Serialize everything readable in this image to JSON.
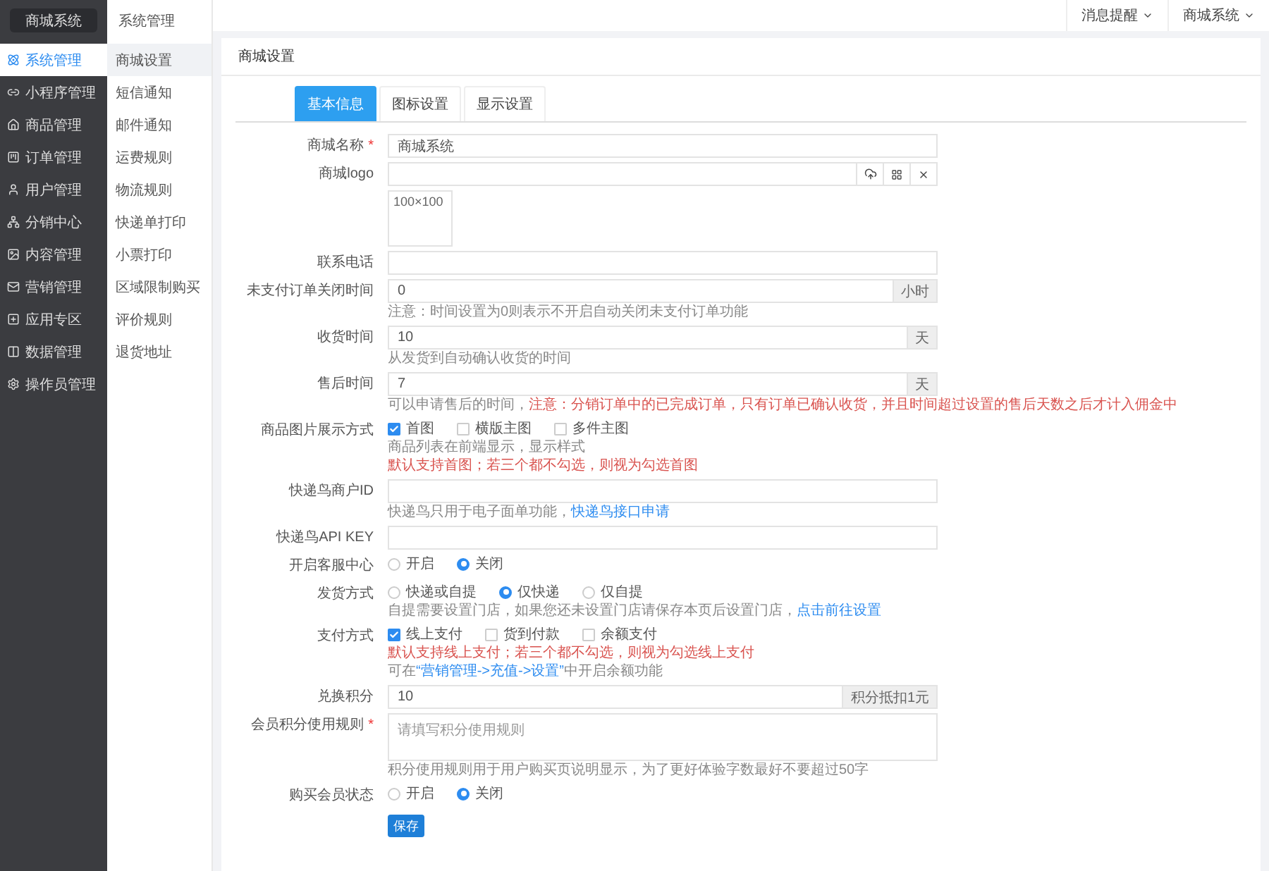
{
  "sidebar": {
    "brand": "商城系统",
    "items": [
      {
        "label": "系统管理",
        "selected": true
      },
      {
        "label": "小程序管理",
        "selected": false
      },
      {
        "label": "商品管理",
        "selected": false
      },
      {
        "label": "订单管理",
        "selected": false
      },
      {
        "label": "用户管理",
        "selected": false
      },
      {
        "label": "分销中心",
        "selected": false
      },
      {
        "label": "内容管理",
        "selected": false
      },
      {
        "label": "营销管理",
        "selected": false
      },
      {
        "label": "应用专区",
        "selected": false
      },
      {
        "label": "数据管理",
        "selected": false
      },
      {
        "label": "操作员管理",
        "selected": false
      }
    ]
  },
  "subnav": {
    "title": "系统管理",
    "items": [
      {
        "label": "商城设置",
        "selected": true
      },
      {
        "label": "短信通知",
        "selected": false
      },
      {
        "label": "邮件通知",
        "selected": false
      },
      {
        "label": "运费规则",
        "selected": false
      },
      {
        "label": "物流规则",
        "selected": false
      },
      {
        "label": "快递单打印",
        "selected": false
      },
      {
        "label": "小票打印",
        "selected": false
      },
      {
        "label": "区域限制购买",
        "selected": false
      },
      {
        "label": "评价规则",
        "selected": false
      },
      {
        "label": "退货地址",
        "selected": false
      }
    ]
  },
  "topbar": {
    "menus": [
      "消息提醒",
      "商城系统"
    ]
  },
  "card": {
    "title": "商城设置",
    "tabs": [
      {
        "label": "基本信息",
        "selected": true
      },
      {
        "label": "图标设置",
        "selected": false
      },
      {
        "label": "显示设置",
        "selected": false
      }
    ]
  },
  "form": {
    "fields": [
      {
        "kind": "text",
        "label": "商城名称",
        "required_mark": "*",
        "value": "商城系统"
      },
      {
        "kind": "upload",
        "label": "商城logo",
        "thumb": "100×100"
      },
      {
        "kind": "text",
        "label": "联系电话"
      },
      {
        "kind": "text",
        "label": "未支付订单关闭时间",
        "value": "0",
        "addon": "小时",
        "help": [
          {
            "kind": "muted",
            "text": "注意：时间设置为0则表示不开启自动关闭未支付订单功能"
          }
        ]
      },
      {
        "kind": "text",
        "label": "收货时间",
        "value": "10",
        "addon": "天",
        "help": [
          {
            "kind": "muted",
            "text": "从发货到自动确认收货的时间"
          }
        ]
      },
      {
        "kind": "text",
        "label": "售后时间",
        "value": "7",
        "addon": "天",
        "help": [
          {
            "kind": "muted",
            "text": "可以申请售后的时间，"
          },
          {
            "kind": "warning",
            "text": "注意：分销订单中的已完成订单，只有订单已确认收货，并且时间超过设置的售后天数之后才计入佣金中"
          }
        ]
      },
      {
        "kind": "checks",
        "label": "商品图片展示方式",
        "options": [
          {
            "label": "首图",
            "checked": true
          },
          {
            "label": "横版主图",
            "checked": false
          },
          {
            "label": "多件主图",
            "checked": false
          }
        ],
        "help": [
          {
            "kind": "muted",
            "text": "商品列表在前端显示，显示样式"
          }
        ],
        "note": [
          {
            "kind": "warning",
            "text": "默认支持首图；若三个都不勾选，则视为勾选首图"
          }
        ]
      },
      {
        "kind": "text",
        "label": "快递鸟商户ID",
        "help": [
          {
            "kind": "muted",
            "text": "快递鸟只用于电子面单功能，"
          },
          {
            "kind": "link",
            "text": "快递鸟接口申请"
          }
        ]
      },
      {
        "kind": "text",
        "label": "快递鸟API KEY"
      },
      {
        "kind": "radios",
        "label": "开启客服中心",
        "options": [
          {
            "label": "开启",
            "selected": false
          },
          {
            "label": "关闭",
            "selected": true
          }
        ]
      },
      {
        "kind": "radios",
        "label": "发货方式",
        "options": [
          {
            "label": "快递或自提",
            "selected": false
          },
          {
            "label": "仅快递",
            "selected": true
          },
          {
            "label": "仅自提",
            "selected": false
          }
        ],
        "help": [
          {
            "kind": "muted",
            "text": "自提需要设置门店，如果您还未设置门店请保存本页后设置门店，"
          },
          {
            "kind": "link",
            "text": "点击前往设置"
          }
        ]
      },
      {
        "kind": "checks",
        "label": "支付方式",
        "options": [
          {
            "label": "线上支付",
            "checked": true
          },
          {
            "label": "货到付款",
            "checked": false
          },
          {
            "label": "余额支付",
            "checked": false
          }
        ],
        "help": [
          {
            "kind": "warning",
            "text": "默认支持线上支付；若三个都不勾选，则视为勾选线上支付"
          }
        ],
        "note": [
          {
            "kind": "muted",
            "text": "可在"
          },
          {
            "kind": "link",
            "text": "“营销管理->充值->设置”"
          },
          {
            "kind": "muted",
            "text": "中开启余额功能"
          }
        ]
      },
      {
        "kind": "text",
        "label": "兑换积分",
        "value": "10",
        "addon": "积分抵扣1元"
      },
      {
        "kind": "textarea",
        "label": "会员积分使用规则",
        "required_mark": "*",
        "placeholder": "请填写积分使用规则",
        "help": [
          {
            "kind": "muted",
            "text": "积分使用规则用于用户购买页说明显示，为了更好体验字数最好不要超过50字"
          }
        ]
      },
      {
        "kind": "radios",
        "label": "购买会员状态",
        "options": [
          {
            "label": "开启",
            "selected": false
          },
          {
            "label": "关闭",
            "selected": true
          }
        ]
      }
    ],
    "submit": "保存"
  }
}
